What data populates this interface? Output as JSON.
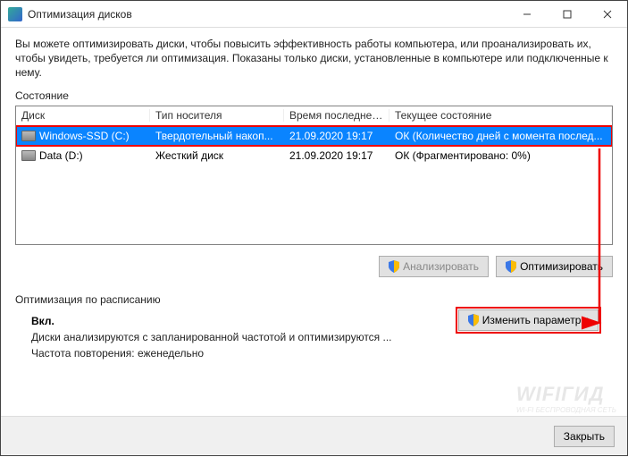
{
  "window": {
    "title": "Оптимизация дисков"
  },
  "description": "Вы можете оптимизировать диски, чтобы повысить эффективность работы  компьютера, или проанализировать их, чтобы увидеть, требуется ли оптимизация. Показаны только диски, установленные в компьютере или подключенные к нему.",
  "state_label": "Состояние",
  "columns": {
    "disk": "Диск",
    "media": "Тип носителя",
    "last": "Время последнег...",
    "status": "Текущее состояние"
  },
  "drives": [
    {
      "name": "Windows-SSD (C:)",
      "media": "Твердотельный накоп...",
      "last": "21.09.2020 19:17",
      "status": "ОК (Количество дней с момента послед...",
      "selected": true
    },
    {
      "name": "Data (D:)",
      "media": "Жесткий диск",
      "last": "21.09.2020 19:17",
      "status": "ОК (Фрагментировано: 0%)",
      "selected": false
    }
  ],
  "buttons": {
    "analyze": "Анализировать",
    "optimize": "Оптимизировать",
    "change": "Изменить параметры",
    "close": "Закрыть"
  },
  "schedule": {
    "header": "Оптимизация по расписанию",
    "status": "Вкл.",
    "line1": "Диски анализируются с запланированной частотой и оптимизируются ...",
    "line2_label": "Частота повторения:",
    "line2_value": "еженедельно"
  },
  "watermark": {
    "main": "WIFIГИД",
    "sub": "WI-FI БЕСПРОВОДНАЯ СЕТЬ"
  }
}
